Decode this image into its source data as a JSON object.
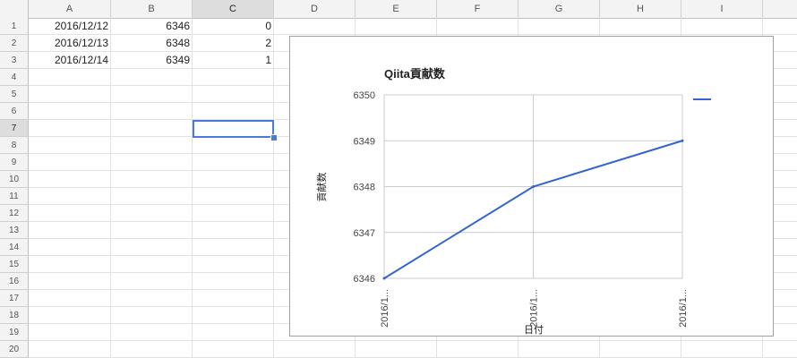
{
  "columns": [
    "A",
    "B",
    "C",
    "D",
    "E",
    "F",
    "G",
    "H",
    "I"
  ],
  "rows": [
    "1",
    "2",
    "3",
    "4",
    "5",
    "6",
    "7",
    "8",
    "9",
    "10",
    "11",
    "12",
    "13",
    "14",
    "15",
    "16",
    "17",
    "18",
    "19",
    "20"
  ],
  "selected_cell": "C7",
  "table": [
    {
      "date": "2016/12/12",
      "value": "6346",
      "delta": "0"
    },
    {
      "date": "2016/12/13",
      "value": "6348",
      "delta": "2"
    },
    {
      "date": "2016/12/14",
      "value": "6349",
      "delta": "1"
    }
  ],
  "colors": {
    "line": "#3366cc",
    "selection": "#4a7bd8",
    "grid": "#e2e2e2"
  },
  "chart_data": {
    "type": "line",
    "title": "Qiita貢献数",
    "xlabel": "日付",
    "ylabel": "貢献数",
    "categories": [
      "2016/1...",
      "2016/1...",
      "2016/1..."
    ],
    "series": [
      {
        "values": [
          6346,
          6348,
          6349
        ]
      }
    ],
    "ylim": [
      6346,
      6350
    ],
    "yticks": [
      "6346",
      "6347",
      "6348",
      "6349",
      "6350"
    ],
    "grid": true,
    "legend": "right"
  }
}
